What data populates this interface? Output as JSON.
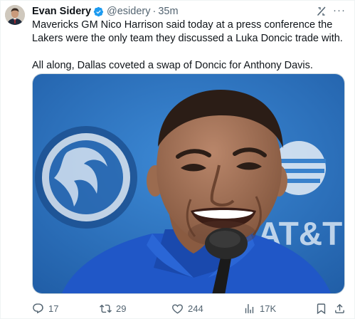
{
  "author": {
    "name": "Evan Sidery",
    "handle": "@esidery",
    "separator": "·",
    "time": "35m"
  },
  "tweet": {
    "paragraph1": "Mavericks GM Nico Harrison said today at a press conference the Lakers were the only team they discussed a Luka Doncic trade with.",
    "paragraph2": "All along, Dallas coveted a swap of Doncic for Anthony Davis."
  },
  "media": {
    "backdrop_logo_text": "AT&T"
  },
  "actions": {
    "replies": "17",
    "reposts": "29",
    "likes": "244",
    "views": "17K"
  },
  "colors": {
    "verified": "#1d9bf0",
    "text_secondary": "#536471",
    "backdrop_blue": "#2f79c9"
  },
  "icons": [
    "verified-badge-icon",
    "grok-icon",
    "more-icon",
    "reply-icon",
    "repost-icon",
    "like-icon",
    "views-icon",
    "bookmark-icon",
    "share-icon"
  ]
}
